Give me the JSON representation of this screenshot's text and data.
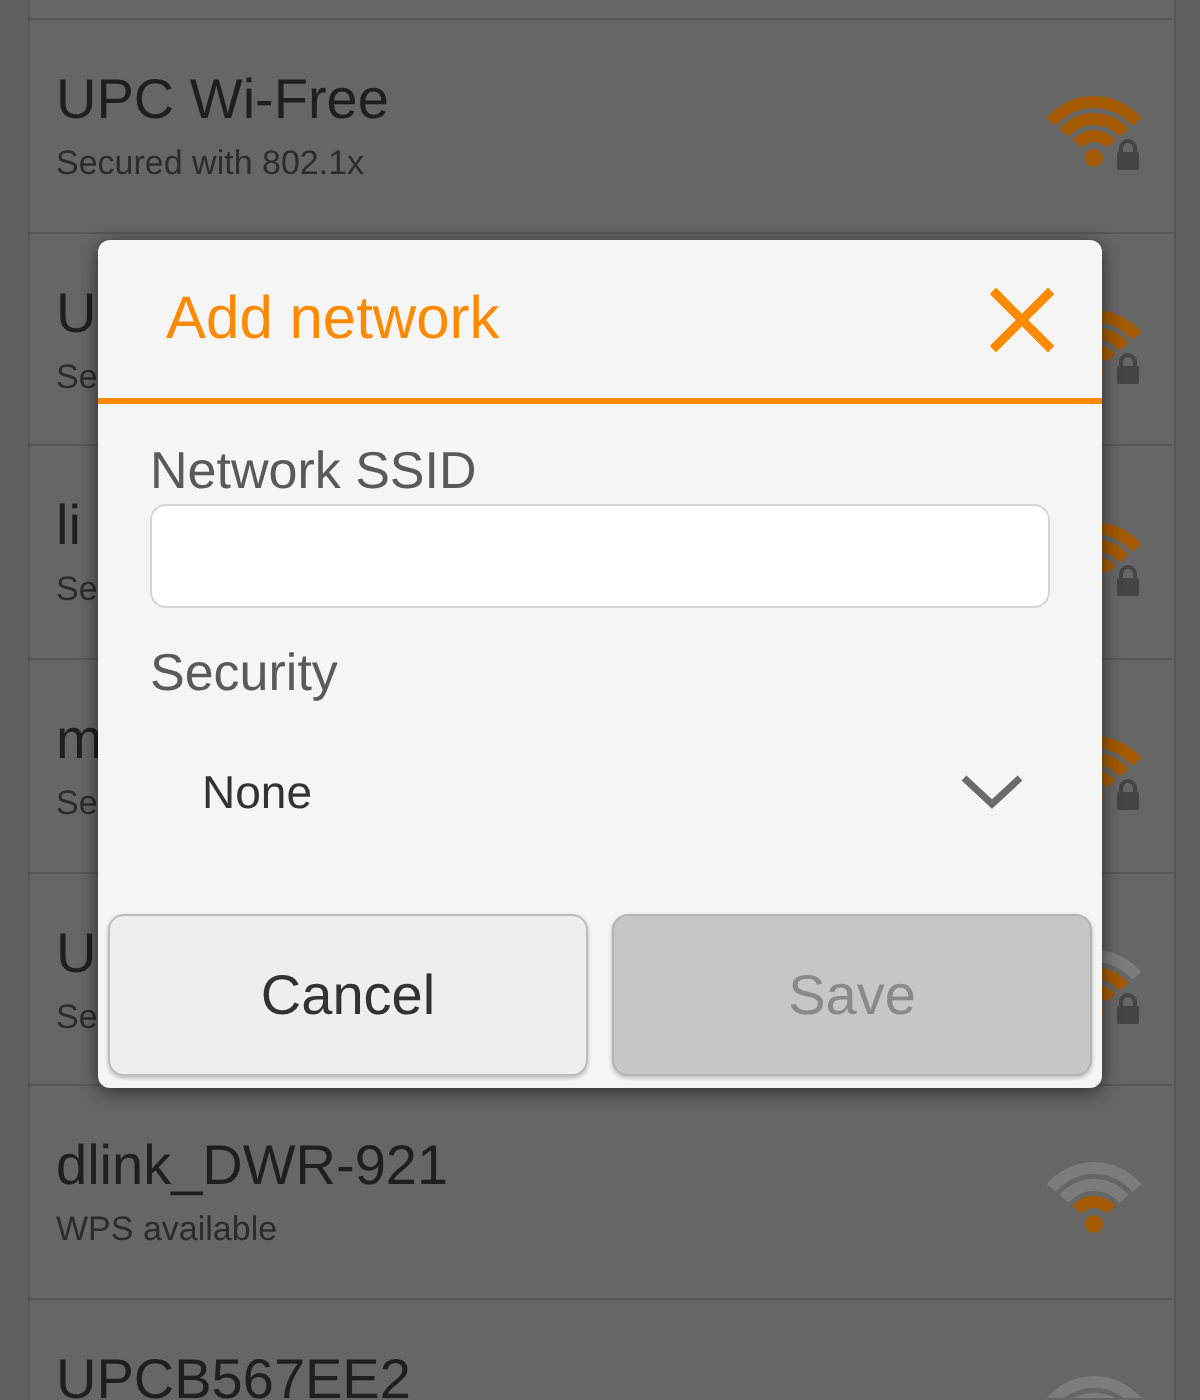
{
  "networks": [
    {
      "name": "UPC Wi-Free",
      "status": "Secured with 802.1x",
      "kind": "strong",
      "secured": true
    },
    {
      "name": "U",
      "status": "Se",
      "kind": "strong",
      "secured": true
    },
    {
      "name": "li",
      "status": "Se",
      "kind": "strong",
      "secured": true
    },
    {
      "name": "m",
      "status": "Se",
      "kind": "strong",
      "secured": true
    },
    {
      "name": "U",
      "status": "Se",
      "kind": "medium",
      "secured": true
    },
    {
      "name": "dlink_DWR-921",
      "status": "WPS available",
      "kind": "weak",
      "secured": false
    },
    {
      "name": "UPCB567EE2",
      "kind": "weak"
    }
  ],
  "dialog": {
    "title": "Add network",
    "fields": [
      {
        "kind": "text",
        "label": "Network SSID"
      },
      {
        "kind": "select",
        "label": "Security",
        "value": "None"
      }
    ],
    "buttons": [
      {
        "label": "Cancel",
        "disabled": false
      },
      {
        "label": "Save",
        "disabled": true
      }
    ]
  }
}
